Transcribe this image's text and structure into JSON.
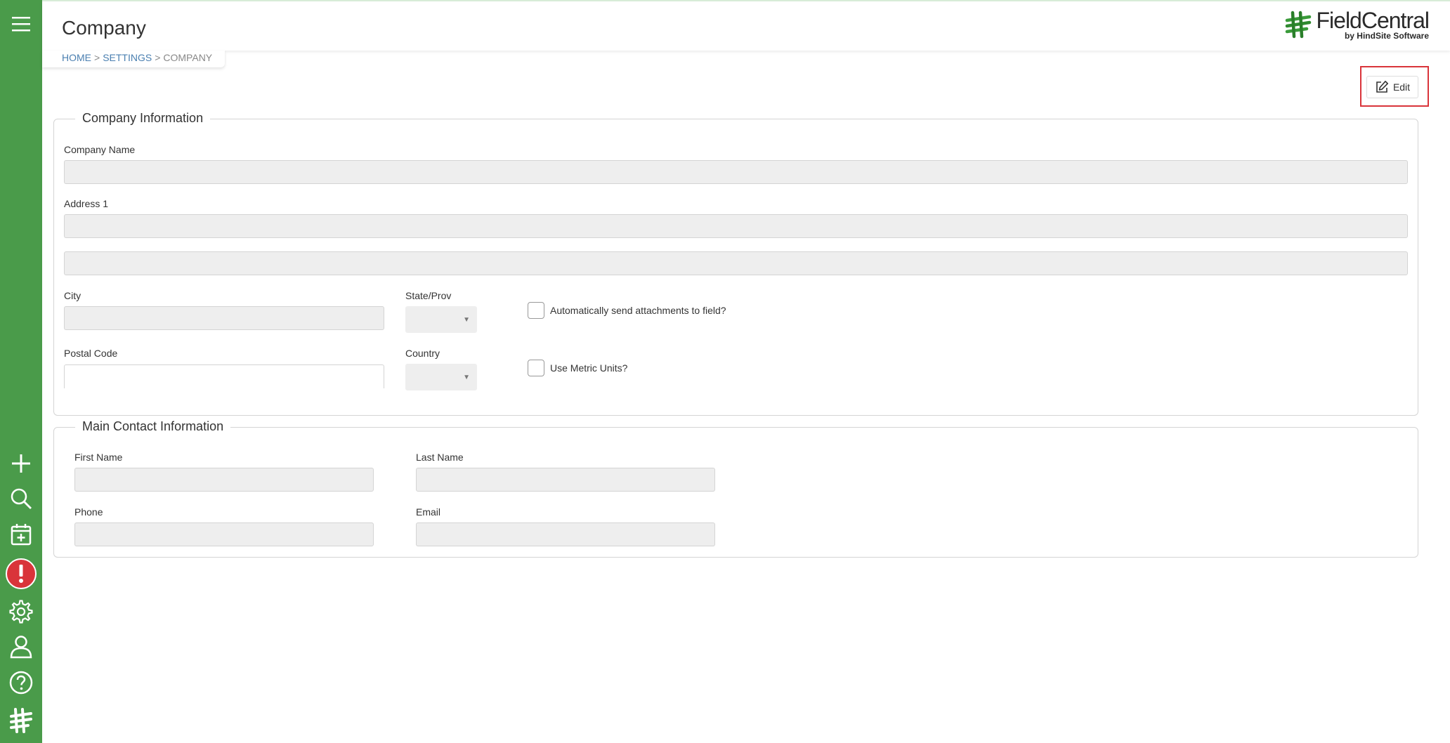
{
  "header": {
    "title": "Company",
    "logo_name": "FieldCentral",
    "logo_sub": "by HindSite Software"
  },
  "breadcrumb": {
    "home": "HOME",
    "settings": "SETTINGS",
    "current": "COMPANY",
    "separator": ">"
  },
  "toolbar": {
    "edit_label": "Edit"
  },
  "company_info": {
    "legend": "Company Information",
    "company_name_label": "Company Name",
    "company_name_value": "",
    "address1_label": "Address 1",
    "address1_value": "",
    "address2_value": "",
    "city_label": "City",
    "city_value": "",
    "state_label": "State/Prov",
    "state_value": "",
    "postal_label": "Postal Code",
    "postal_value": "",
    "country_label": "Country",
    "country_value": "",
    "auto_send_label": "Automatically send attachments to field?",
    "metric_label": "Use Metric Units?"
  },
  "main_contact": {
    "legend": "Main Contact Information",
    "first_name_label": "First Name",
    "last_name_label": "Last Name",
    "phone_label": "Phone",
    "email_label": "Email"
  },
  "colors": {
    "sidebar": "#4a9b4a",
    "alert": "#d9343a",
    "link": "#4a7fb0"
  },
  "sidebar_icons": [
    "menu-icon",
    "plus-icon",
    "search-icon",
    "calendar-add-icon",
    "alert-icon",
    "gear-icon",
    "user-icon",
    "help-icon",
    "fieldcentral-logo-icon"
  ]
}
